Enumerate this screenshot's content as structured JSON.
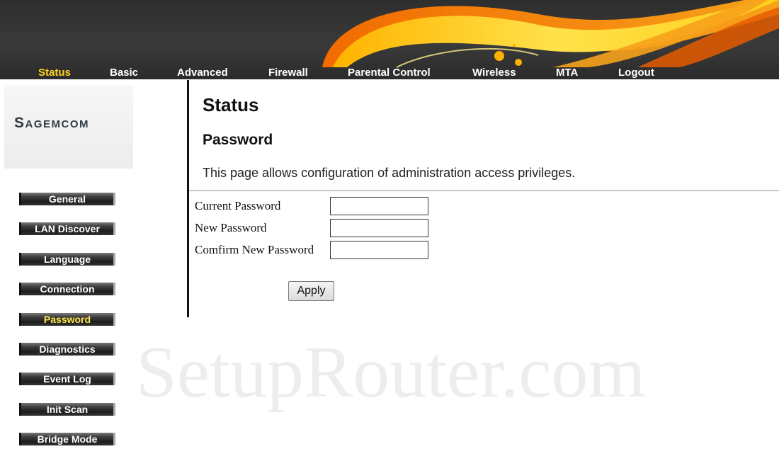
{
  "top_nav": {
    "items": [
      "Status",
      "Basic",
      "Advanced",
      "Firewall",
      "Parental Control",
      "Wireless",
      "MTA",
      "Logout"
    ],
    "active": "Status"
  },
  "brand": {
    "logo_text": "Sagemcom"
  },
  "sidebar": {
    "items": [
      "General",
      "LAN Discover",
      "Language",
      "Connection",
      "Password",
      "Diagnostics",
      "Event Log",
      "Init Scan",
      "Bridge Mode"
    ],
    "active": "Password"
  },
  "main": {
    "title": "Status",
    "subtitle": "Password",
    "description": "This page allows configuration of administration access privileges.",
    "fields": [
      {
        "label": "Current Password",
        "value": "",
        "placeholder": ""
      },
      {
        "label": "New Password",
        "value": "",
        "placeholder": ""
      },
      {
        "label": "Comfirm New Password",
        "value": "",
        "placeholder": ""
      }
    ],
    "apply_label": "Apply"
  },
  "watermark": "SetupRouter.com",
  "colors": {
    "banner_bg": "#333333",
    "nav_active": "#ffd21f",
    "sidebar_active": "#ffe94a",
    "swoosh_orange": "#f39a12",
    "swoosh_yellow": "#ffd21f"
  }
}
